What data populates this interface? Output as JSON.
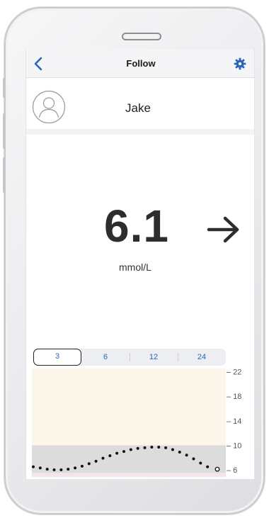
{
  "nav": {
    "title": "Follow"
  },
  "profile": {
    "name": "Jake"
  },
  "reading": {
    "value": "6.1",
    "unit": "mmol/L",
    "trend": "steady-right-arrow"
  },
  "time_range": {
    "options": [
      "3",
      "6",
      "12",
      "24"
    ],
    "selected": "3"
  },
  "colors": {
    "accent": "#2a66b8",
    "high_zone": "#fcf6ea",
    "target_zone": "#dcdcdc",
    "low_zone": "#f6e4e6",
    "readings": "#111111"
  },
  "chart_data": {
    "type": "scatter",
    "y_ticks": [
      "22",
      "18",
      "14",
      "10",
      "6"
    ],
    "ylim": [
      4.5,
      23
    ],
    "zones": [
      {
        "name": "high",
        "from": 10,
        "to": 22
      },
      {
        "name": "target",
        "from": 5.5,
        "to": 10
      }
    ],
    "values": [
      6.5,
      6.3,
      6.1,
      6.0,
      6.0,
      6.1,
      6.3,
      6.6,
      7.0,
      7.4,
      7.9,
      8.3,
      8.7,
      9.0,
      9.3,
      9.5,
      9.6,
      9.7,
      9.7,
      9.6,
      9.3,
      8.9,
      8.4,
      7.8,
      7.1,
      6.5,
      6.1
    ]
  }
}
